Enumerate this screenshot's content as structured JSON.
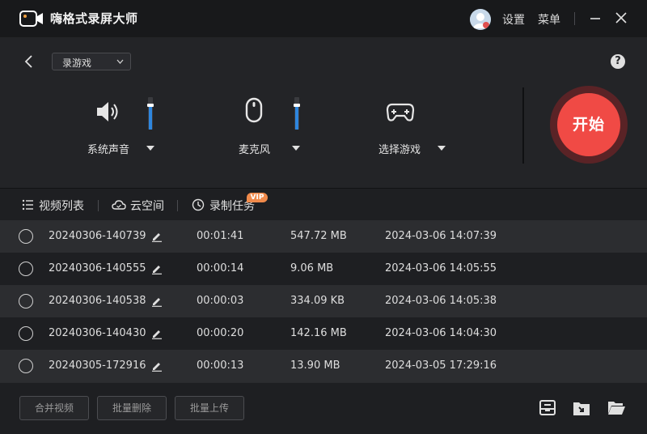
{
  "titlebar": {
    "app_title": "嗨格式录屏大师",
    "settings_label": "设置",
    "menu_label": "菜单"
  },
  "top": {
    "mode_select": "录游戏",
    "help_glyph": "?",
    "system_audio_label": "系统声音",
    "system_audio_level": 0.75,
    "mic_label": "麦克风",
    "mic_level": 0.75,
    "game_label": "选择游戏",
    "start_label": "开始"
  },
  "tabs": [
    {
      "label": "视频列表"
    },
    {
      "label": "云空间"
    },
    {
      "label": "录制任务",
      "badge": "VIP"
    }
  ],
  "recordings": [
    {
      "name": "20240306-140739",
      "duration": "00:01:41",
      "size": "547.72 MB",
      "date": "2024-03-06 14:07:39"
    },
    {
      "name": "20240306-140555",
      "duration": "00:00:14",
      "size": "9.06 MB",
      "date": "2024-03-06 14:05:55"
    },
    {
      "name": "20240306-140538",
      "duration": "00:00:03",
      "size": "334.09 KB",
      "date": "2024-03-06 14:05:38"
    },
    {
      "name": "20240306-140430",
      "duration": "00:00:20",
      "size": "142.16 MB",
      "date": "2024-03-06 14:04:30"
    },
    {
      "name": "20240305-172916",
      "duration": "00:00:13",
      "size": "13.90 MB",
      "date": "2024-03-05 17:29:16"
    }
  ],
  "bottom": {
    "merge_label": "合并视频",
    "delete_label": "批量删除",
    "upload_label": "批量上传"
  },
  "colors": {
    "accent": "#2e86de",
    "start": "#f04a45",
    "vip": "#f08a4b"
  },
  "icons": [
    "app-logo-icon",
    "avatar",
    "minimize-icon",
    "close-icon",
    "back-icon",
    "speaker-icon",
    "mouse-icon",
    "gamepad-icon",
    "list-icon",
    "cloud-icon",
    "clock-icon",
    "edit-icon",
    "archive-icon",
    "export-icon",
    "folder-icon"
  ]
}
